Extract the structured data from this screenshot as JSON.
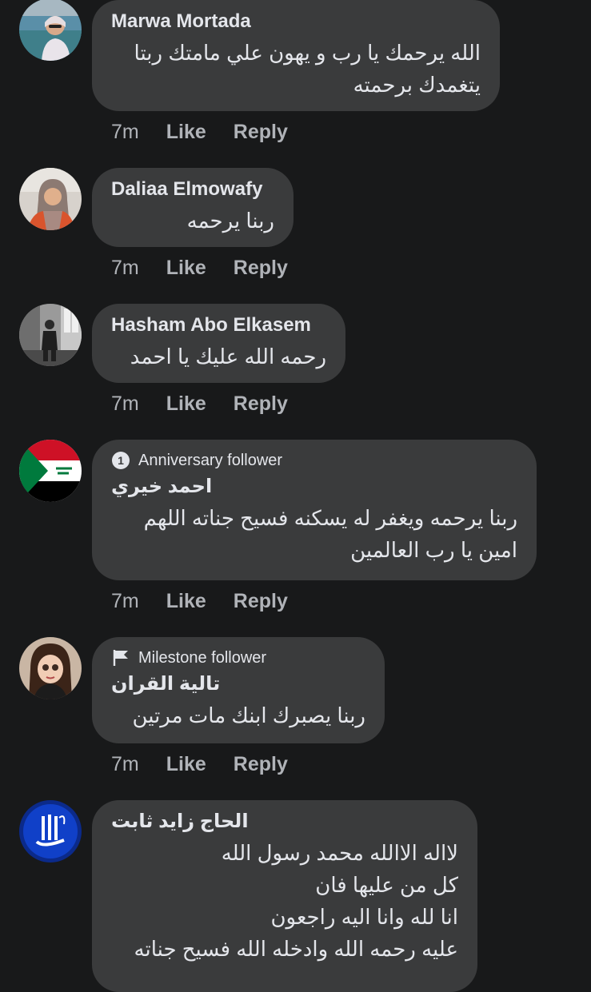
{
  "comments": [
    {
      "author": "Marwa Mortada",
      "badge": null,
      "lines": [
        "الله يرحمك يا رب و يهون علي مامتك  ربتا",
        "يتغمدك برحمته"
      ],
      "time": "7m",
      "like": "Like",
      "reply": "Reply"
    },
    {
      "author": "Daliaa Elmowafy",
      "badge": null,
      "lines": [
        "ربنا يرحمه"
      ],
      "time": "7m",
      "like": "Like",
      "reply": "Reply"
    },
    {
      "author": "Hasham Abo Elkasem",
      "badge": null,
      "lines": [
        "رحمه الله عليك يا احمد"
      ],
      "time": "7m",
      "like": "Like",
      "reply": "Reply"
    },
    {
      "author": "احمد خيري",
      "badge": "Anniversary follower",
      "badge_icon": "anniversary-icon",
      "lines": [
        "ربنا يرحمه ويغفر له يسكنه فسيح جناته اللهم",
        "امين يا رب العالمين"
      ],
      "time": "7m",
      "like": "Like",
      "reply": "Reply"
    },
    {
      "author": "تالية القران",
      "badge": "Milestone follower",
      "badge_icon": "flag-icon",
      "lines": [
        "ربنا يصبرك ابنك مات  مرتين"
      ],
      "time": "7m",
      "like": "Like",
      "reply": "Reply"
    },
    {
      "author": "الحاج زايد ثابت",
      "badge": null,
      "lines": [
        "لااله الاالله  محمد رسول الله",
        "كل من عليها فان",
        "انا لله وانا اليه راجعون",
        "عليه رحمه الله وادخله الله فسيح جناته"
      ]
    }
  ],
  "colors": {
    "background": "#18191a",
    "bubble": "#3a3b3c",
    "text": "#e4e6eb",
    "secondary": "#b0b3b8"
  }
}
